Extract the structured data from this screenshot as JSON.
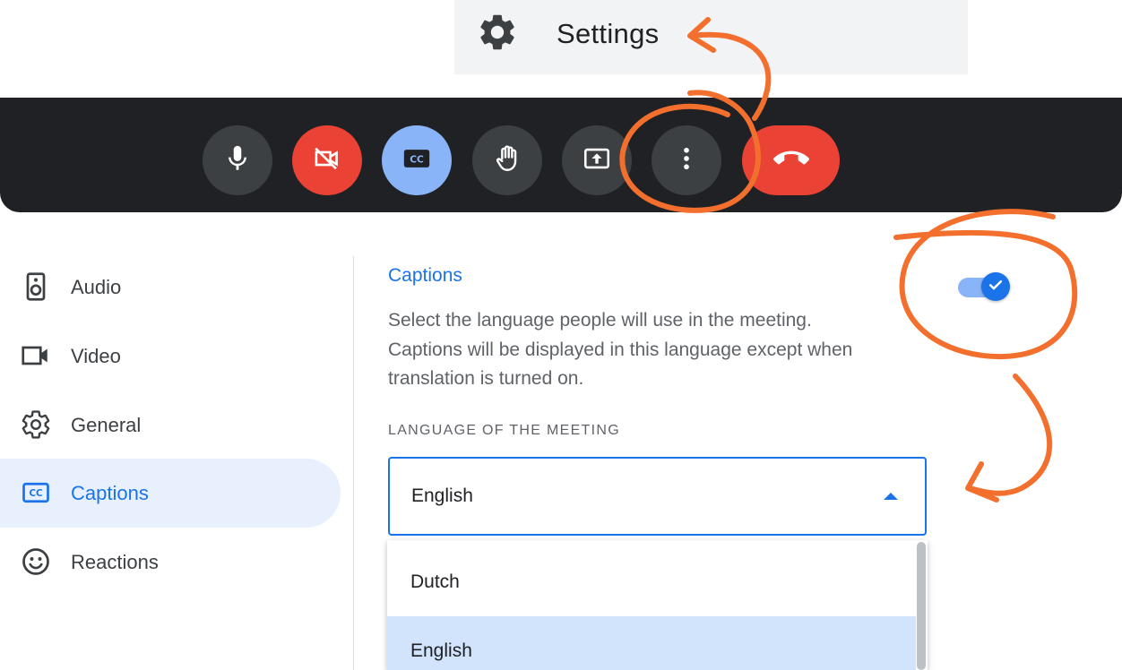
{
  "settings_menu": {
    "label": "Settings",
    "icon": "gear-icon"
  },
  "toolbar": {
    "buttons": [
      {
        "name": "microphone",
        "icon": "microphone-icon",
        "color": "#3c4043"
      },
      {
        "name": "camera-off",
        "icon": "camera-off-icon",
        "color": "#ea4335"
      },
      {
        "name": "captions",
        "icon": "closed-captions-icon",
        "color": "#8ab4f8"
      },
      {
        "name": "raise-hand",
        "icon": "hand-icon",
        "color": "#3c4043"
      },
      {
        "name": "present",
        "icon": "present-screen-icon",
        "color": "#3c4043"
      },
      {
        "name": "more-options",
        "icon": "more-vertical-icon",
        "color": "#3c4043"
      },
      {
        "name": "leave-call",
        "icon": "hang-up-icon",
        "color": "#ea4335"
      }
    ]
  },
  "sidebar": {
    "items": [
      {
        "label": "Audio",
        "icon": "speaker-icon"
      },
      {
        "label": "Video",
        "icon": "video-camera-icon"
      },
      {
        "label": "General",
        "icon": "gear-icon"
      },
      {
        "label": "Captions",
        "icon": "closed-captions-icon",
        "active": true
      },
      {
        "label": "Reactions",
        "icon": "smiley-icon"
      }
    ]
  },
  "captions": {
    "title": "Captions",
    "description": "Select the language people will use in the meeting. Captions will be displayed in this language except when translation is turned on.",
    "toggle_on": true,
    "language_label": "LANGUAGE OF THE MEETING",
    "selected_language": "English",
    "options": [
      "Dutch",
      "English"
    ]
  },
  "colors": {
    "accent": "#1a73e8",
    "annotation": "#f36f2e",
    "toolbar_bg": "#202124",
    "danger": "#ea4335"
  }
}
